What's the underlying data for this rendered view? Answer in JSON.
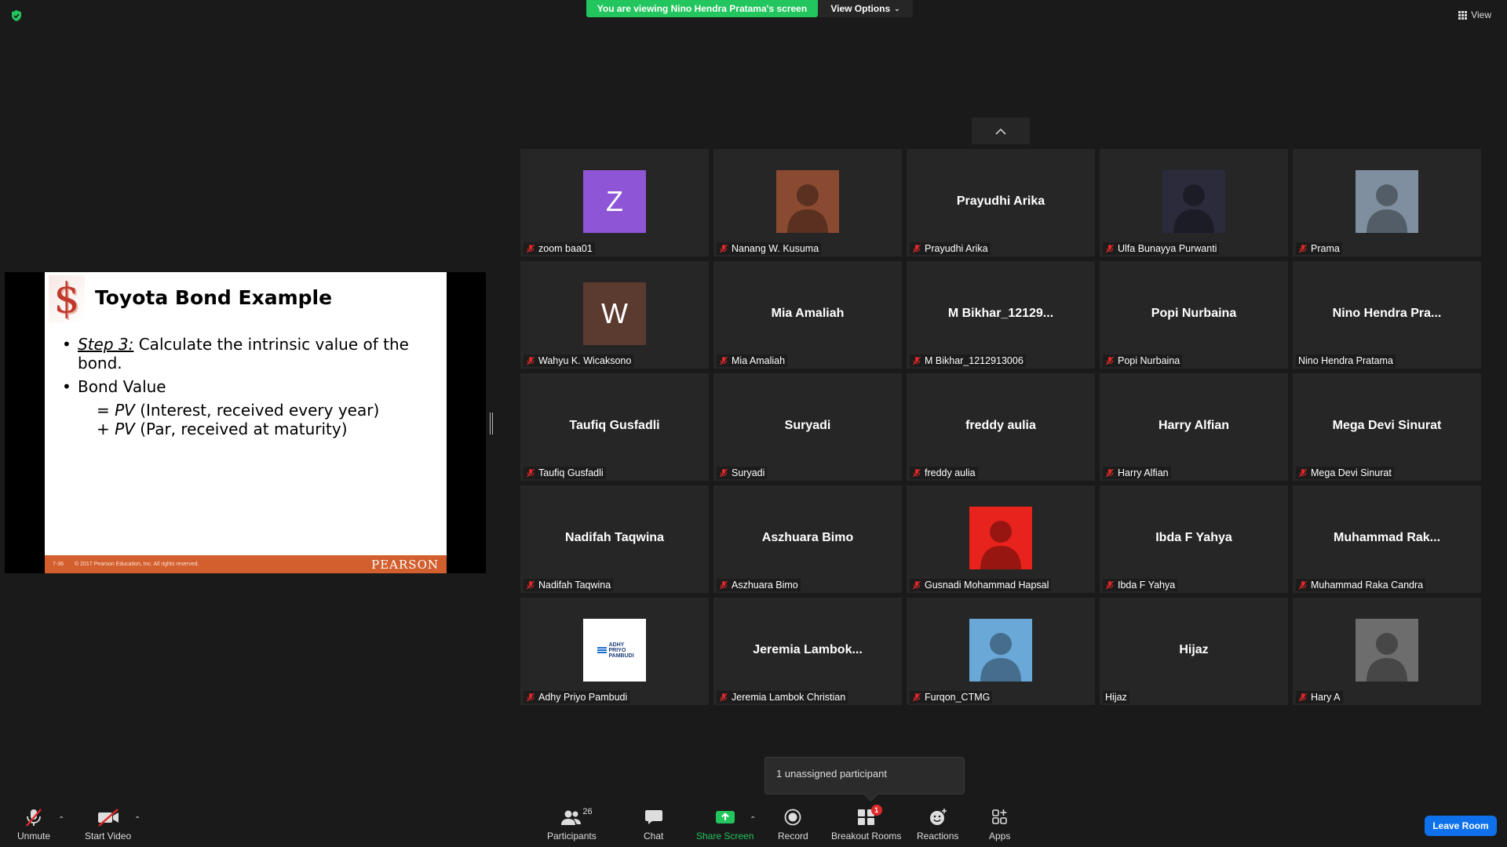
{
  "banner": {
    "viewing": "You are viewing Nino Hendra Pratama's screen",
    "view_options": "View Options",
    "view": "View"
  },
  "slide": {
    "logo": "$",
    "title": "Toyota Bond Example",
    "step_label": "Step 3:",
    "step_text": " Calculate the intrinsic value of the bond.",
    "bond_value": "Bond Value",
    "line1_pre": "= ",
    "line1_pv": "PV",
    "line1_post": " (Interest, received every year)",
    "line2_pre": "+ ",
    "line2_pv": "PV",
    "line2_post": " (Par, received at maturity)",
    "footer_page": "7-36",
    "footer_copy": "© 2017 Pearson Education, Inc. All rights reserved.",
    "footer_brand": "PEARSON"
  },
  "participants": [
    {
      "label": "zoom baa01",
      "kind": "letter",
      "letter": "Z",
      "color": "#8e55d6",
      "muted": true
    },
    {
      "label": "Nanang W. Kusuma",
      "kind": "photo",
      "color": "#8a4a32",
      "muted": true
    },
    {
      "label": "Prayudhi Arika",
      "kind": "name",
      "big": "Prayudhi Arika",
      "muted": true
    },
    {
      "label": "Ulfa Bunayya Purwanti",
      "kind": "photo",
      "color": "#2b2b3c",
      "muted": true
    },
    {
      "label": "Prama",
      "kind": "photo",
      "color": "#7f8fa0",
      "muted": true
    },
    {
      "label": "Wahyu K. Wicaksono",
      "kind": "letter",
      "letter": "W",
      "color": "#5b3a30",
      "muted": true
    },
    {
      "label": "Mia Amaliah",
      "kind": "name",
      "big": "Mia Amaliah",
      "muted": true
    },
    {
      "label": "M Bikhar_1212913006",
      "kind": "name",
      "big": "M  Bikhar_12129...",
      "muted": true
    },
    {
      "label": "Popi Nurbaina",
      "kind": "name",
      "big": "Popi Nurbaina",
      "muted": true
    },
    {
      "label": "Nino Hendra Pratama",
      "kind": "name",
      "big": "Nino  Hendra  Pra...",
      "muted": false
    },
    {
      "label": "Taufiq Gusfadli",
      "kind": "name",
      "big": "Taufiq Gusfadli",
      "muted": true
    },
    {
      "label": "Suryadi",
      "kind": "name",
      "big": "Suryadi",
      "muted": true
    },
    {
      "label": "freddy aulia",
      "kind": "name",
      "big": "freddy aulia",
      "muted": true
    },
    {
      "label": "Harry Alfian",
      "kind": "name",
      "big": "Harry Alfian",
      "muted": true
    },
    {
      "label": "Mega Devi Sinurat",
      "kind": "name",
      "big": "Mega Devi Sinurat",
      "muted": true
    },
    {
      "label": "Nadifah Taqwina",
      "kind": "name",
      "big": "Nadifah Taqwina",
      "muted": true
    },
    {
      "label": "Aszhuara Bimo",
      "kind": "name",
      "big": "Aszhuara Bimo",
      "muted": true
    },
    {
      "label": "Gusnadi Mohammad Hapsal",
      "kind": "photo",
      "color": "#e8221c",
      "muted": true
    },
    {
      "label": "Ibda F Yahya",
      "kind": "name",
      "big": "Ibda F Yahya",
      "muted": true
    },
    {
      "label": "Muhammad Raka Candra",
      "kind": "name",
      "big": "Muhammad  Rak...",
      "muted": true
    },
    {
      "label": "Adhy Priyo Pambudi",
      "kind": "logo",
      "logo_text": "ADHY PRIYO PAMBUDI",
      "color": "#ffffff",
      "muted": true
    },
    {
      "label": "Jeremia Lambok Christian",
      "kind": "name",
      "big": "Jeremia  Lambok...",
      "muted": true
    },
    {
      "label": "Furqon_CTMG",
      "kind": "photo",
      "color": "#6aa8d8",
      "muted": true
    },
    {
      "label": "Hijaz",
      "kind": "name",
      "big": "Hijaz",
      "muted": false
    },
    {
      "label": "Hary A",
      "kind": "photo",
      "color": "#6d6d6d",
      "muted": true
    }
  ],
  "popup": {
    "text": "1 unassigned participant"
  },
  "toolbar": {
    "unmute": "Unmute",
    "start_video": "Start Video",
    "participants": "Participants",
    "participants_count": "26",
    "chat": "Chat",
    "share_screen": "Share Screen",
    "record": "Record",
    "breakout_rooms": "Breakout Rooms",
    "breakout_badge": "1",
    "reactions": "Reactions",
    "apps": "Apps",
    "leave_room": "Leave Room"
  }
}
